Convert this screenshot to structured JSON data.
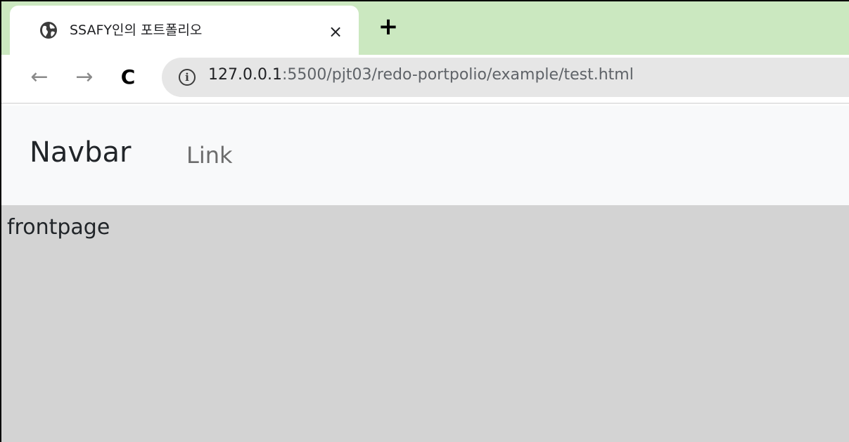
{
  "browser": {
    "tab": {
      "title": "SSAFY인의 포트폴리오",
      "icon": "globe-icon",
      "close_label": "×"
    },
    "new_tab_label": "+",
    "toolbar": {
      "back_label": "←",
      "forward_label": "→",
      "reload_label": "C",
      "info_label": "i",
      "url_host": "127.0.0.1",
      "url_path": ":5500/pjt03/redo-portpolio/example/test.html"
    },
    "colors": {
      "tabstrip": "#cbe8c0",
      "omnibox": "#e6e6e6"
    }
  },
  "page": {
    "navbar": {
      "brand": "Navbar",
      "link": "Link",
      "background": "#f8f9fa"
    },
    "frontpage": {
      "text": "frontpage",
      "background": "#d3d3d3"
    }
  }
}
